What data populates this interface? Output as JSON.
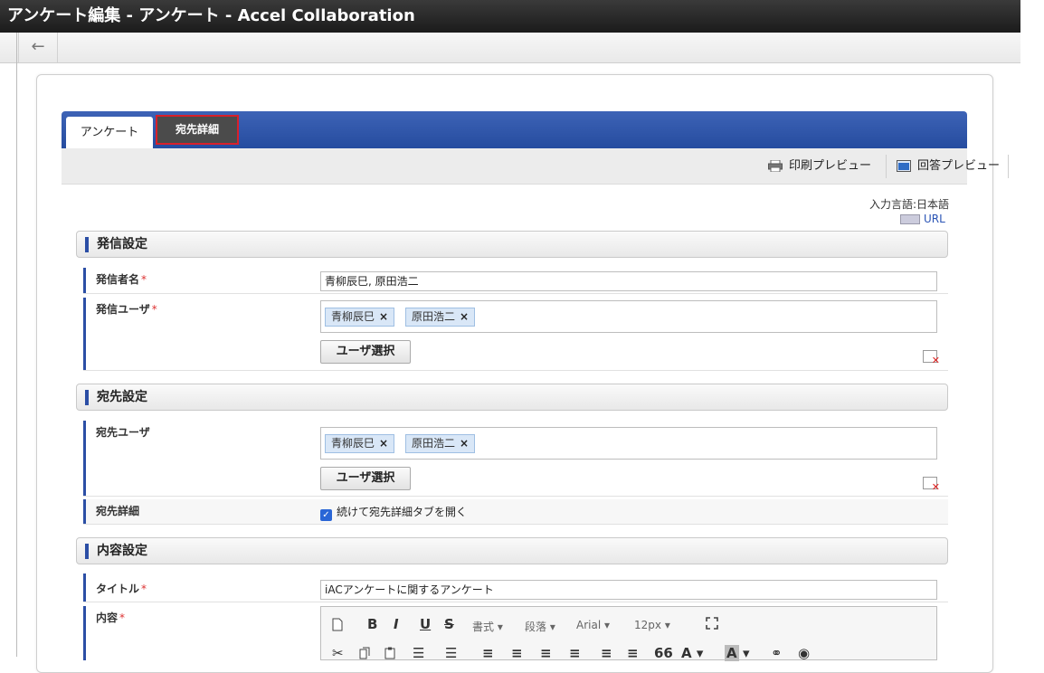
{
  "window": {
    "title": "アンケート編集 - アンケート - Accel Collaboration"
  },
  "toolbar": {
    "back_icon": "←"
  },
  "tabs": [
    {
      "label": "アンケート"
    },
    {
      "label": "宛先詳細"
    }
  ],
  "actions": {
    "print_preview": "印刷プレビュー",
    "answer_preview": "回答プレビュー"
  },
  "input_language": "入力言語:日本語",
  "url_label": "URL",
  "sections": {
    "sender": {
      "title": "発信設定",
      "sender_name_label": "発信者名",
      "sender_name_value": "青柳辰巳, 原田浩二",
      "sender_user_label": "発信ユーザ",
      "sender_users": [
        "青柳辰巳",
        "原田浩二"
      ],
      "select_user_button": "ユーザ選択"
    },
    "recipient": {
      "title": "宛先設定",
      "recipient_user_label": "宛先ユーザ",
      "recipient_users": [
        "青柳辰巳",
        "原田浩二"
      ],
      "select_user_button": "ユーザ選択",
      "detail_label": "宛先詳細",
      "detail_checkbox_label": "続けて宛先詳細タブを開く",
      "detail_checkbox_checked": true
    },
    "content": {
      "title": "内容設定",
      "title_label": "タイトル",
      "title_value": "iACアンケートに関するアンケート",
      "body_label": "内容"
    }
  },
  "required_mark": "*",
  "remove_mark": "×",
  "editor_toolbar": {
    "row1": {
      "bold": "B",
      "italic": "I",
      "underline": "U",
      "strike": "S",
      "format": "書式",
      "paragraph": "段落",
      "font": "Arial",
      "size": "12px"
    },
    "row2": {
      "quote": "66",
      "font_color": "A",
      "bg_color": "A"
    }
  }
}
